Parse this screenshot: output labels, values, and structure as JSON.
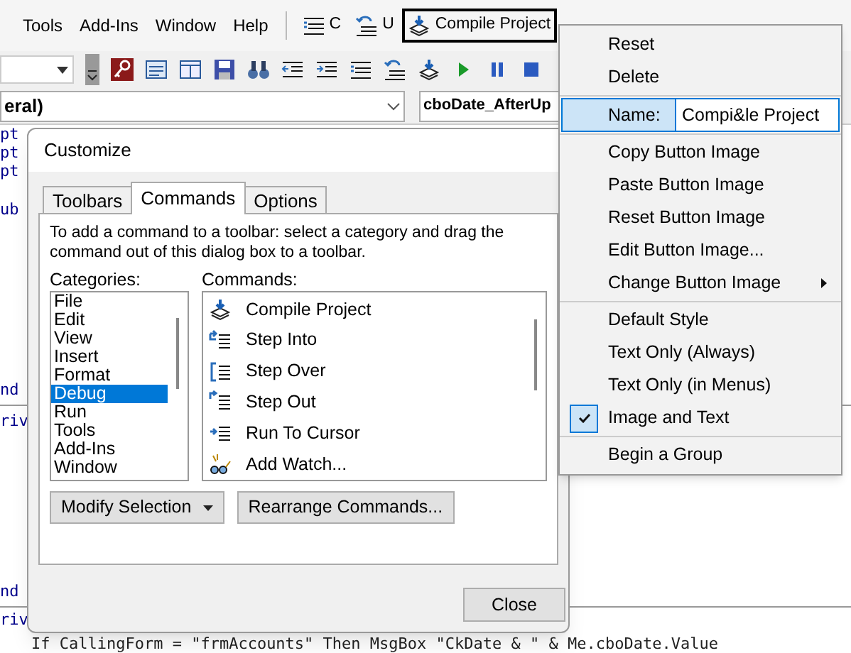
{
  "menubar": [
    {
      "label": "Tools"
    },
    {
      "label": "Add-Ins"
    },
    {
      "label": "Window"
    },
    {
      "label": "Help"
    }
  ],
  "custom_buttons": [
    {
      "label": "C",
      "kind": "comment",
      "selected": false
    },
    {
      "label": "U",
      "kind": "uncomment",
      "selected": false
    },
    {
      "label": "Compile Project",
      "kind": "compile",
      "selected": true
    }
  ],
  "code_window": {
    "object_combo": "eral)",
    "procedure_combo": "cboDate_AfterUp",
    "lines": [
      {
        "text": "pt",
        "kind": "keyword",
        "separator_after": false
      },
      {
        "text": "pt",
        "kind": "keyword",
        "separator_after": false
      },
      {
        "text": "pt",
        "kind": "keyword",
        "separator_after": false
      },
      {
        "text": "ub",
        "kind": "keyword",
        "separator_after": false
      },
      {
        "text": "nd",
        "kind": "keyword",
        "separator_after": true
      },
      {
        "text": "riv",
        "kind": "keyword",
        "separator_after": false
      },
      {
        "text": "nd",
        "kind": "keyword",
        "separator_after": true
      },
      {
        "text": "riv",
        "kind": "keyword",
        "separator_after": false
      },
      {
        "text": "If CallingForm = \"frmAccounts\" Then MsgBox \"CkDate & \" & Me.cboDate.Value",
        "kind": "statement",
        "separator_after": false
      }
    ]
  },
  "dialog": {
    "title": "Customize",
    "tabs": [
      {
        "label": "Toolbars",
        "selected": false
      },
      {
        "label": "Commands",
        "selected": true
      },
      {
        "label": "Options",
        "selected": false
      }
    ],
    "instructions": "To add a command to a toolbar: select a category and drag the command out of this dialog box to a toolbar.",
    "categories_label": "Categories:",
    "categories": [
      {
        "label": "File",
        "selected": false
      },
      {
        "label": "Edit",
        "selected": false
      },
      {
        "label": "View",
        "selected": false
      },
      {
        "label": "Insert",
        "selected": false
      },
      {
        "label": "Format",
        "selected": false
      },
      {
        "label": "Debug",
        "selected": true
      },
      {
        "label": "Run",
        "selected": false
      },
      {
        "label": "Tools",
        "selected": false
      },
      {
        "label": "Add-Ins",
        "selected": false
      },
      {
        "label": "Window",
        "selected": false
      }
    ],
    "commands_label": "Commands:",
    "commands": [
      {
        "label": "Compile Project",
        "kind": "compile"
      },
      {
        "label": "Step Into",
        "kind": "step_into"
      },
      {
        "label": "Step Over",
        "kind": "step_over"
      },
      {
        "label": "Step Out",
        "kind": "step_out"
      },
      {
        "label": "Run To Cursor",
        "kind": "run_to_cursor"
      },
      {
        "label": "Add Watch...",
        "kind": "watch"
      }
    ],
    "modify_button": "Modify Selection",
    "rearrange_button": "Rearrange Commands...",
    "close_button": "Close"
  },
  "context_menu": [
    {
      "label": "Reset",
      "kind": "item",
      "separator_after": false
    },
    {
      "label": "Delete",
      "kind": "item",
      "separator_after": true
    },
    {
      "label": "Name:",
      "kind": "field",
      "value": "Compi&le Project",
      "separator_after": true
    },
    {
      "label": "Copy Button Image",
      "kind": "item",
      "separator_after": false
    },
    {
      "label": "Paste Button Image",
      "kind": "item",
      "separator_after": false
    },
    {
      "label": "Reset Button Image",
      "kind": "item",
      "separator_after": false
    },
    {
      "label": "Edit Button Image...",
      "kind": "item",
      "separator_after": false
    },
    {
      "label": "Change Button Image",
      "kind": "submenu",
      "separator_after": true
    },
    {
      "label": "Default Style",
      "kind": "item",
      "checked": false,
      "separator_after": false
    },
    {
      "label": "Text Only (Always)",
      "kind": "item",
      "checked": false,
      "separator_after": false
    },
    {
      "label": "Text Only (in Menus)",
      "kind": "item",
      "checked": false,
      "separator_after": false
    },
    {
      "label": "Image and Text",
      "kind": "item",
      "checked": true,
      "separator_after": true
    },
    {
      "label": "Begin a Group",
      "kind": "item",
      "separator_after": false
    }
  ]
}
